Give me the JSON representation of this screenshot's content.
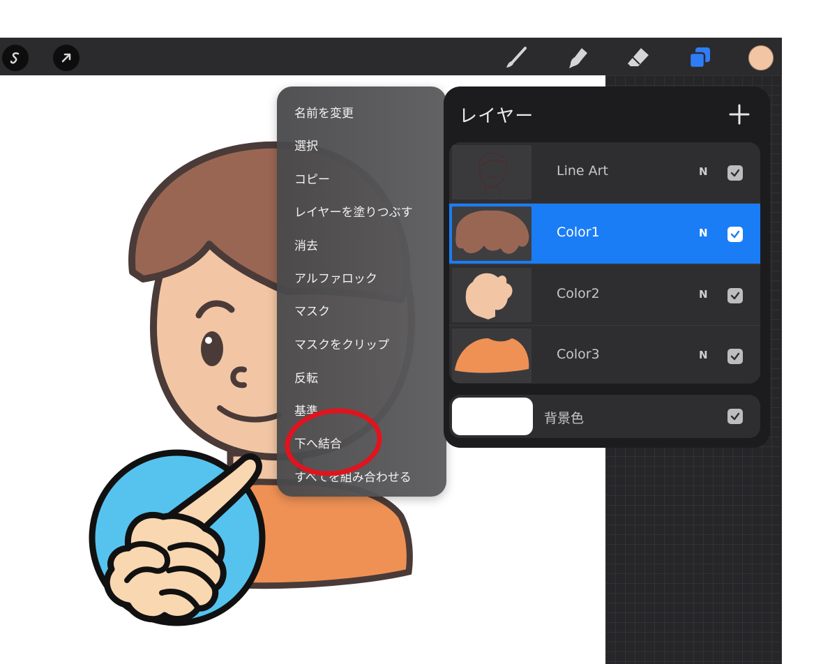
{
  "context_menu": {
    "items": [
      {
        "label": "名前を変更"
      },
      {
        "label": "選択"
      },
      {
        "label": "コピー"
      },
      {
        "label": "レイヤーを塗りつぶす"
      },
      {
        "label": "消去"
      },
      {
        "label": "アルファロック"
      },
      {
        "label": "マスク"
      },
      {
        "label": "マスクをクリップ"
      },
      {
        "label": "反転"
      },
      {
        "label": "基準"
      },
      {
        "label": "下へ結合"
      },
      {
        "label": "すべてを組み合わせる"
      }
    ],
    "highlighted": "下へ結合"
  },
  "layers_panel": {
    "title": "レイヤー",
    "layers": [
      {
        "name": "Line Art",
        "blend_mode": "N",
        "visible": true,
        "selected": false
      },
      {
        "name": "Color1",
        "blend_mode": "N",
        "visible": true,
        "selected": true
      },
      {
        "name": "Color2",
        "blend_mode": "N",
        "visible": true,
        "selected": false
      },
      {
        "name": "Color3",
        "blend_mode": "N",
        "visible": true,
        "selected": false
      }
    ],
    "background": {
      "label": "背景色",
      "visible": true
    }
  },
  "toolbar": {
    "left_icons": [
      "selection-icon",
      "transform-arrow-icon"
    ],
    "right_icons": [
      "brush-icon",
      "smudge-icon",
      "eraser-icon",
      "layers-icon"
    ],
    "current_color": "#f2c6a4"
  },
  "colors": {
    "accent": "#1a7df5",
    "highlight_ring": "#e0141e",
    "hair": "#9a6654",
    "skin": "#f2c6a4",
    "shirt": "#ef9155"
  }
}
